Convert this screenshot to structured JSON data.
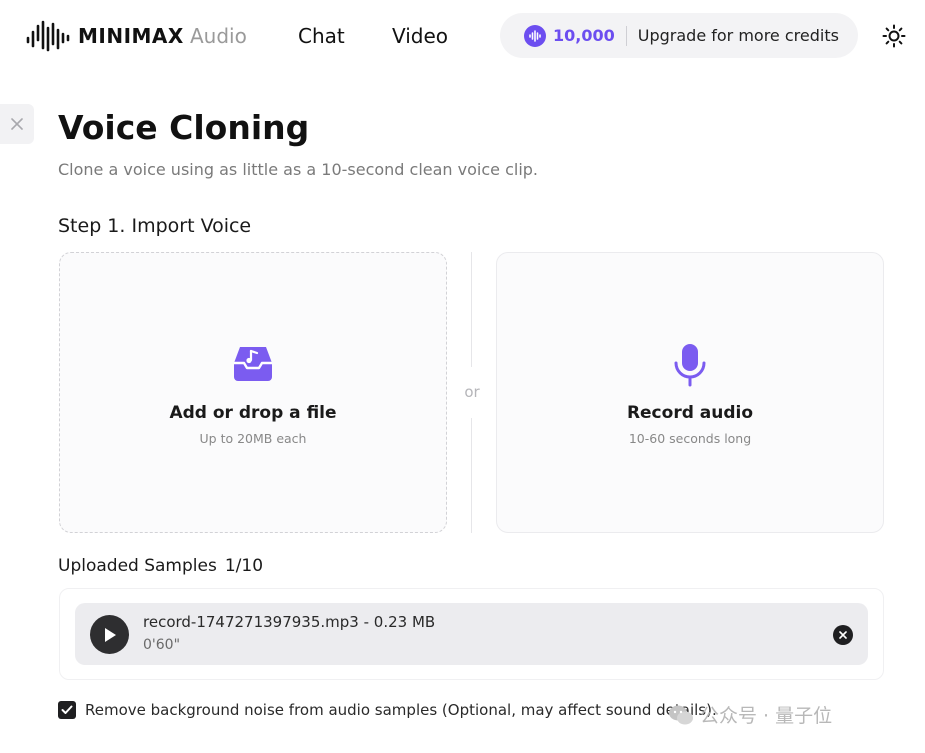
{
  "header": {
    "brand": "MINIMAX",
    "nav": [
      {
        "label": "Audio"
      },
      {
        "label": "Chat"
      },
      {
        "label": "Video"
      }
    ],
    "credits": {
      "amount": "10,000",
      "upgrade_label": "Upgrade for more credits"
    },
    "theme_icon": "sun-icon"
  },
  "page": {
    "title": "Voice Cloning",
    "subtitle": "Clone a voice using as little as a 10-second clean voice clip.",
    "step_title": "Step 1. Import Voice"
  },
  "import": {
    "file": {
      "icon": "music-file-tray-icon",
      "title": "Add or drop a file",
      "sub": "Up to 20MB each"
    },
    "separator": "or",
    "record": {
      "icon": "microphone-icon",
      "title": "Record audio",
      "sub": "10-60 seconds long"
    }
  },
  "samples": {
    "title": "Uploaded Samples",
    "count": "1/10",
    "items": [
      {
        "name": "record-1747271397935.mp3 - 0.23 MB",
        "duration": "0'60\""
      }
    ]
  },
  "options": {
    "noise_label": "Remove background noise from audio samples (Optional, may affect sound details).",
    "noise_checked": true
  },
  "watermark": {
    "text": "公众号 · 量子位"
  },
  "colors": {
    "accent": "#6c4ef0",
    "dark": "#1f1f21"
  }
}
